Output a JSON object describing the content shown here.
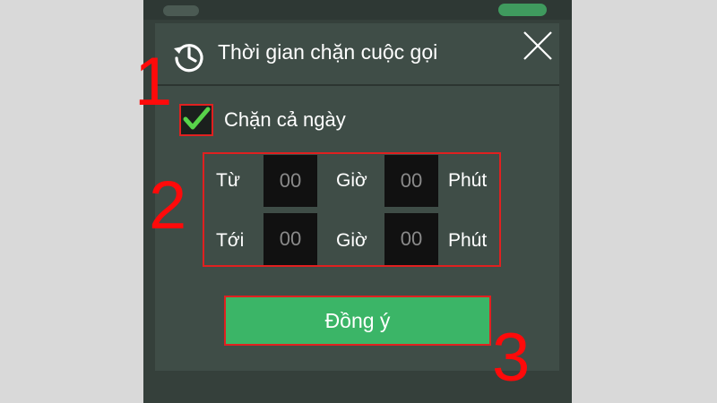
{
  "dialog": {
    "title": "Thời gian chặn cuộc gọi",
    "header_icon": "history-icon",
    "close_icon": "close-icon"
  },
  "block_all_day": {
    "label": "Chặn cả ngày",
    "checked": true
  },
  "time_range": {
    "from": {
      "label": "Từ",
      "hour": "00",
      "hour_unit": "Giờ",
      "minute": "00",
      "minute_unit": "Phút"
    },
    "to": {
      "label": "Tới",
      "hour": "00",
      "hour_unit": "Giờ",
      "minute": "00",
      "minute_unit": "Phút"
    }
  },
  "confirm_button": {
    "label": "Đồng ý"
  },
  "annotations": [
    "1",
    "2",
    "3"
  ],
  "colors": {
    "dialog_bg": "#3f4d47",
    "accent_green": "#3bb567",
    "highlight_red": "#e02020",
    "check_green": "#58d34a"
  }
}
